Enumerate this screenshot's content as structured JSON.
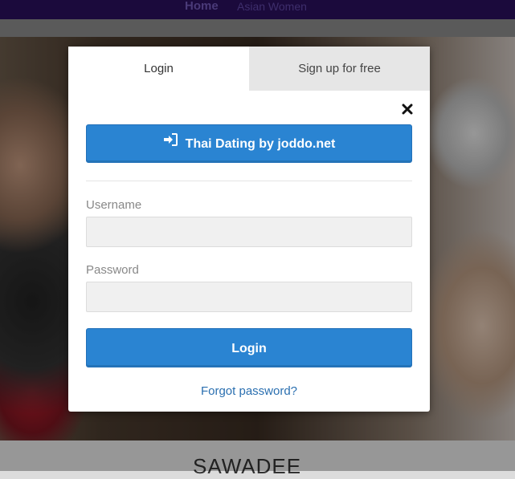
{
  "nav": {
    "home": "Home",
    "asian_women": "Asian Women"
  },
  "hero": {
    "heading": "SAWADEE"
  },
  "modal": {
    "tabs": {
      "login": "Login",
      "signup": "Sign up for free"
    },
    "site_button_label": "Thai Dating by joddo.net",
    "username_label": "Username",
    "username_value": "",
    "password_label": "Password",
    "password_value": "",
    "login_button_label": "Login",
    "forgot_password": "Forgot password?",
    "close_icon": "close-icon",
    "site_button_icon": "sign-in-icon"
  },
  "colors": {
    "accent": "#2a84d2",
    "link": "#2a6fb0",
    "nav_bg": "#1b0a3c",
    "inactive_tab": "#e6e6e6"
  }
}
